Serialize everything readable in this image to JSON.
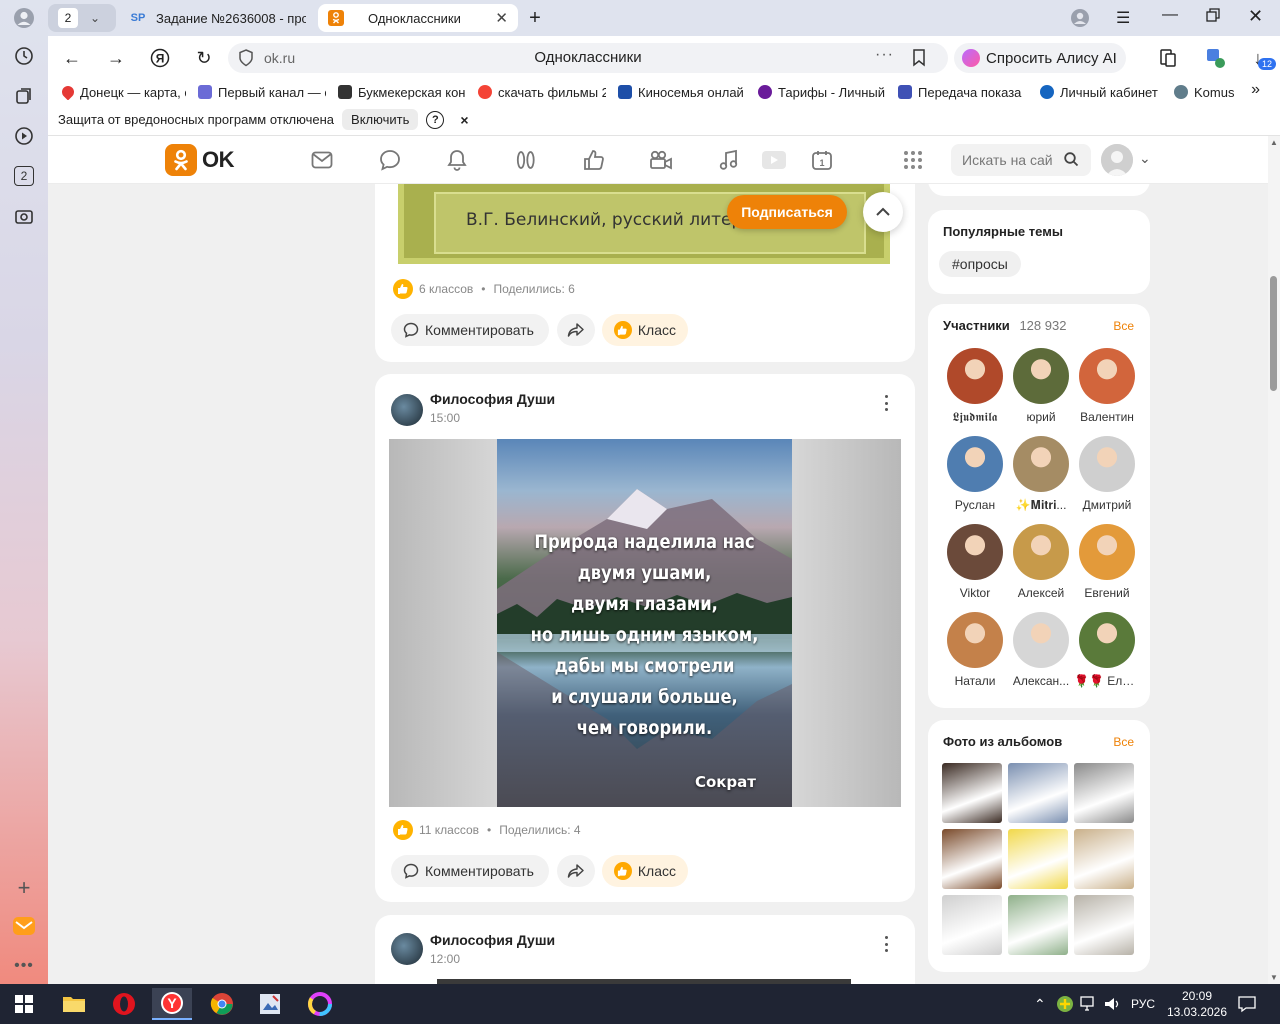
{
  "browser": {
    "tab_count": "2",
    "tabs": [
      {
        "label": "Задание №2636008 - про",
        "favicon": "SP"
      },
      {
        "label": "Одноклассники",
        "favicon": "ok"
      }
    ],
    "address": {
      "url": "ok.ru",
      "page_title": "Одноклассники"
    },
    "alice_label": "Спросить Алису AI",
    "downloads_badge": "12",
    "sidebar_badge": "2",
    "bookmarks": [
      {
        "label": "Донецк — карта, с",
        "color": "#e53935"
      },
      {
        "label": "Первый канал — с",
        "color": "#6b6bd6"
      },
      {
        "label": "Букмекерская кон",
        "color": "#333333"
      },
      {
        "label": "скачать фильмы 2",
        "color": "#f44336"
      },
      {
        "label": "Киносемья онлай",
        "color": "#1e4fa8"
      },
      {
        "label": "Тарифы - Личный",
        "color": "#6a1b9a"
      },
      {
        "label": "Передача показа",
        "color": "#3f51b5"
      },
      {
        "label": "Личный кабинет",
        "color": "#1565c0"
      },
      {
        "label": "Komus",
        "color": "#607d8b"
      }
    ],
    "protection": {
      "message": "Защита от вредоносных программ отключена",
      "enable_label": "Включить",
      "help": "?",
      "close": "×"
    }
  },
  "ok": {
    "logo_text": "OK",
    "search_placeholder": "Искать на сай",
    "subscribe_label": "Подписаться"
  },
  "feed": {
    "post0": {
      "image_caption": "В.Г. Белинский, русский литер",
      "likes": "6 классов",
      "shares": "Поделились: 6",
      "comment_label": "Комментировать",
      "class_label": "Класс"
    },
    "post1": {
      "author": "Философия Души",
      "time": "15:00",
      "quote_lines": [
        "Природа наделила нас",
        "двумя ушами,",
        "двумя глазами,",
        "но лишь одним языком,",
        "дабы мы смотрели",
        "и слушали больше,",
        "чем говорили."
      ],
      "quote_author": "Сократ",
      "likes": "11 классов",
      "shares": "Поделились: 4",
      "comment_label": "Комментировать",
      "class_label": "Класс"
    },
    "post2": {
      "author": "Философия Души",
      "time": "12:00"
    }
  },
  "right": {
    "popular_title": "Популярные темы",
    "popular_tag": "#опросы",
    "members_title": "Участники",
    "members_count": "128 932",
    "all_label": "Все",
    "members": [
      {
        "name": "𝕷𝖏𝖚𝖉𝖒𝖎𝖑𝖆",
        "color": "#b0492a"
      },
      {
        "name": "юрий",
        "color": "#5d6b3a"
      },
      {
        "name": "Валентин",
        "color": "#d2653c"
      },
      {
        "name": "Руслан",
        "color": "#4f7db0"
      },
      {
        "name": "✨𝐌𝐢𝐭𝐫𝐢...",
        "color": "#a58c64"
      },
      {
        "name": "Дмитрий",
        "color": "#cfcfcf"
      },
      {
        "name": "Viktor",
        "color": "#6b4a3a"
      },
      {
        "name": "Алексей",
        "color": "#c79a4a"
      },
      {
        "name": "Евгений",
        "color": "#e39a3a"
      },
      {
        "name": "Натали",
        "color": "#c4814a"
      },
      {
        "name": "Алексан...",
        "color": "#d6d6d6"
      },
      {
        "name": "🌹🌹 Елена",
        "color": "#5a7a3a"
      }
    ],
    "photos_title": "Фото из альбомов",
    "photos_all": "Все",
    "photos": [
      {
        "color": "#3a2a22"
      },
      {
        "color": "#7a8fb0"
      },
      {
        "color": "#8a8a8a"
      },
      {
        "color": "#7a4a2a"
      },
      {
        "color": "#f1d84a"
      },
      {
        "color": "#c9b08a"
      },
      {
        "color": "#cfcfcf"
      },
      {
        "color": "#8fb08a"
      },
      {
        "color": "#b7b2a8"
      }
    ]
  },
  "taskbar": {
    "lang": "РУС",
    "time": "20:09",
    "date": "13.03.2026"
  }
}
